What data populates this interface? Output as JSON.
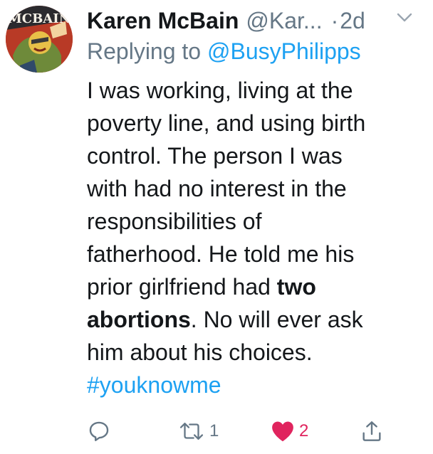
{
  "tweet": {
    "display_name": "Karen McBain",
    "handle": "@Kar...",
    "dot": "·",
    "time": "2d",
    "replying_prefix": "Replying to ",
    "replying_to": "@BusyPhilipps",
    "avatar_text": "MCBAIN",
    "body_lines": [
      "I was working, living at the",
      "poverty line, and using birth",
      "control. The person I was",
      "with had no interest in the",
      "responsibilities of",
      "fatherhood. He told me his"
    ],
    "line7_normal": "prior girlfriend had ",
    "line7_bold": "two",
    "line8_bold": "abortions",
    "line8_normal": ". No will ever ask",
    "line9": "him about his choices.",
    "hashtag": "#youknowme"
  },
  "actions": {
    "retweet_count": "1",
    "like_count": "2"
  },
  "icons": {
    "reply": "reply-icon",
    "retweet": "retweet-icon",
    "like": "heart-icon",
    "share": "share-icon",
    "more": "chevron-down-icon"
  },
  "colors": {
    "link": "#1da1f2",
    "secondary": "#657786",
    "like": "#e0245e",
    "text": "#14171a"
  }
}
